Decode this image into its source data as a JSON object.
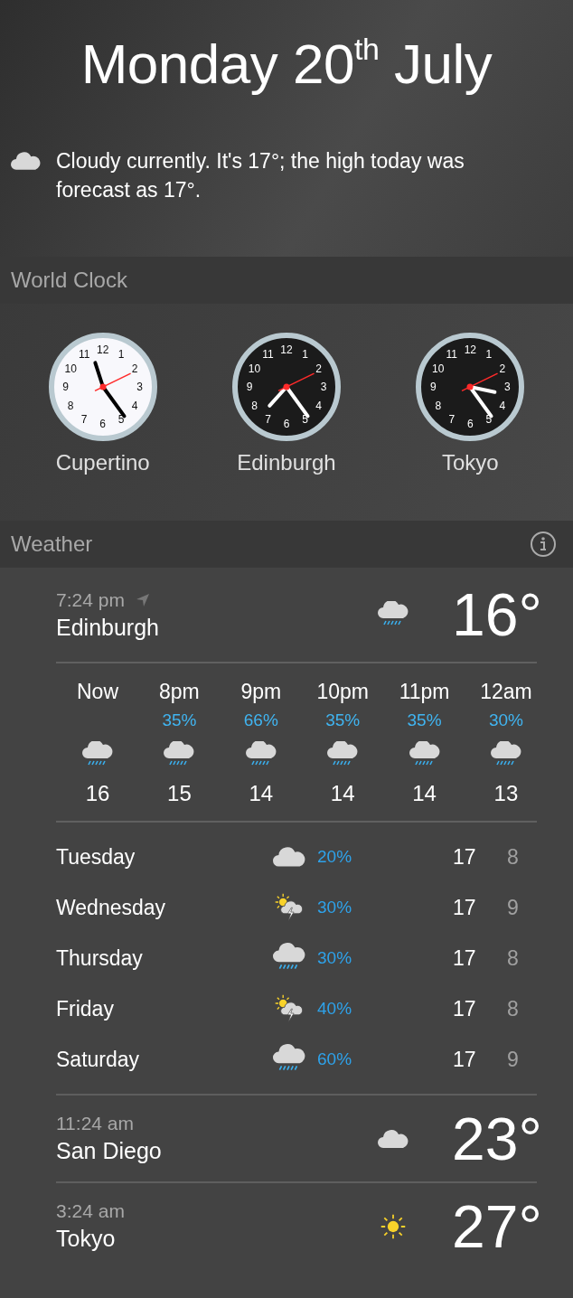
{
  "header": {
    "date": "Monday 20$^{th}$ July",
    "summary": "Cloudy currently. It's 17°; the high today was forecast as 17°.",
    "kind": "cloud"
  },
  "world_clock": {
    "title": "World Clock",
    "clocks": [
      {
        "kind": "light",
        "numerals": [
          "12",
          "11",
          "1",
          "10",
          "2",
          "9",
          "3",
          "8",
          "4",
          "7",
          "5",
          "6"
        ],
        "city": "Cupertino"
      },
      {
        "kind": "dark",
        "numerals": [
          "12",
          "11",
          "1",
          "10",
          "2",
          "9",
          "3",
          "8",
          "4",
          "7",
          "5",
          "6"
        ],
        "city": "Edinburgh"
      },
      {
        "kind": "dark",
        "numerals": [
          "12",
          "11",
          "1",
          "10",
          "2",
          "9",
          "3",
          "8",
          "4",
          "7",
          "5",
          "6"
        ],
        "city": "Tokyo"
      }
    ]
  },
  "weather": {
    "title": "Weather",
    "locations": [
      {
        "time": "7:24 pm",
        "current_location": true,
        "city": "Edinburgh",
        "kind": "rain",
        "temp": "16°",
        "hourly": [
          {
            "label": "Now",
            "kind": "rain",
            "temp": "16"
          },
          {
            "label": "8pm",
            "chance": "35%",
            "kind": "rain",
            "temp": "15"
          },
          {
            "label": "9pm",
            "chance": "66%",
            "kind": "rain",
            "temp": "14"
          },
          {
            "label": "10pm",
            "chance": "35%",
            "kind": "rain",
            "temp": "14"
          },
          {
            "label": "11pm",
            "chance": "35%",
            "kind": "rain",
            "temp": "14"
          },
          {
            "label": "12am",
            "chance": "30%",
            "kind": "rain",
            "temp": "13"
          }
        ],
        "daily": [
          {
            "day": "Tuesday",
            "kind": "cloud",
            "chance": "20%",
            "high": "17",
            "low": "8"
          },
          {
            "day": "Wednesday",
            "kind": "storm",
            "chance": "30%",
            "high": "17",
            "low": "9"
          },
          {
            "day": "Thursday",
            "kind": "rain",
            "chance": "30%",
            "high": "17",
            "low": "8"
          },
          {
            "day": "Friday",
            "kind": "storm",
            "chance": "40%",
            "high": "17",
            "low": "8"
          },
          {
            "day": "Saturday",
            "kind": "rain",
            "chance": "60%",
            "high": "17",
            "low": "9"
          }
        ]
      },
      {
        "time": "11:24 am",
        "current_location": false,
        "city": "San Diego",
        "kind": "cloud",
        "temp": "23°"
      },
      {
        "time": "3:24 am",
        "current_location": false,
        "city": "Tokyo",
        "kind": "sun",
        "temp": "27°"
      }
    ]
  }
}
